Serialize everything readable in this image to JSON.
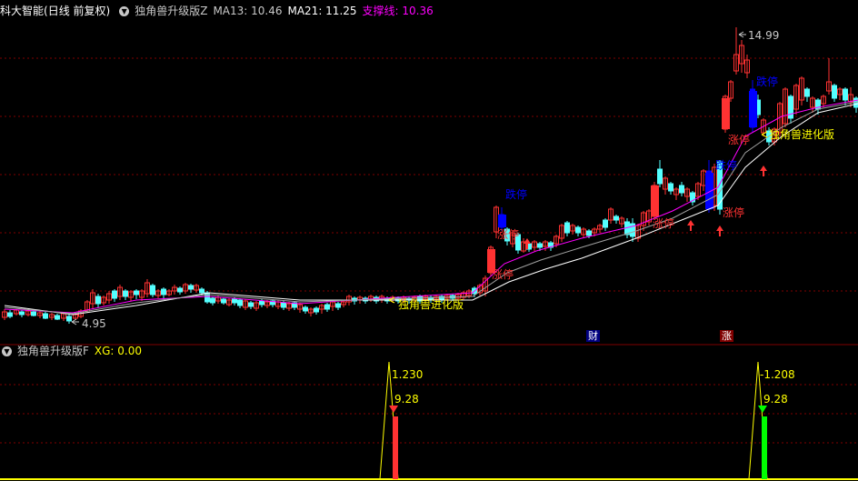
{
  "main_panel": {
    "stock_name": "科大智能",
    "period_label": "(日线 前复权)",
    "indicator_name": "独角兽升级版Z",
    "ma13_label": "MA13: 10.46",
    "ma21_label": "MA21: 11.25",
    "support_label": "支撑线: 10.36",
    "high_marker": "14.99",
    "low_marker": "4.95",
    "annotations": {
      "limit_down_1": "跌停",
      "limit_up_1": "涨停",
      "limit_up_2": "涨停",
      "limit_up_3": "涨停",
      "limit_down_2": "跌停",
      "limit_down_3": "跌停",
      "limit_up_4": "涨停",
      "limit_up_5": "涨停",
      "signal_1": "独角兽进化版",
      "signal_2": "独角兽进化版"
    },
    "bottom_tags": {
      "finance": "财",
      "limit": "涨"
    }
  },
  "sub_panel": {
    "indicator_name": "独角兽升级版F",
    "xg_label": "XG: 0.00",
    "peak_1": "1.230",
    "value_1": "9.28",
    "peak_2": "-1.208",
    "value_2": "9.28"
  },
  "colors": {
    "up": "#ff3232",
    "down": "#54ffff",
    "limit": "#0000ff",
    "ma_white": "#ffffff",
    "ma_purple": "#ff00ff",
    "signal_yellow": "#ffff00",
    "grid": "#800000"
  }
}
